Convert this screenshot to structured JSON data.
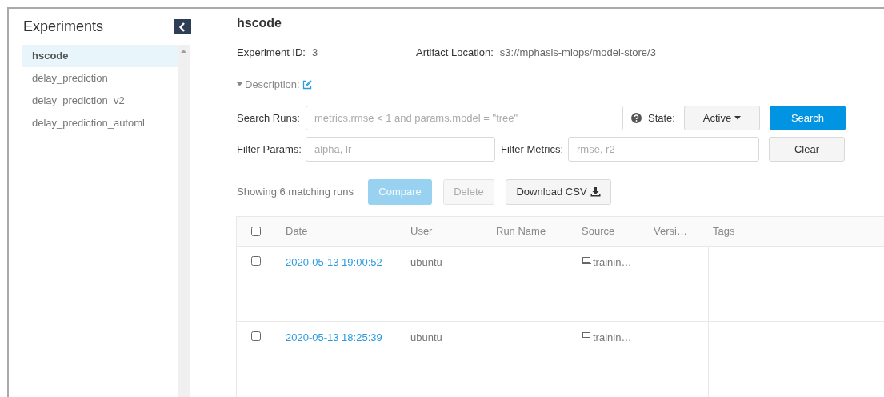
{
  "sidebar": {
    "title": "Experiments",
    "items": [
      {
        "label": "hscode",
        "selected": true
      },
      {
        "label": "delay_prediction",
        "selected": false
      },
      {
        "label": "delay_prediction_v2",
        "selected": false
      },
      {
        "label": "delay_prediction_automl",
        "selected": false
      }
    ]
  },
  "experiment": {
    "title": "hscode",
    "id_label": "Experiment ID:",
    "id_value": "3",
    "location_label": "Artifact Location:",
    "location_value": "s3://mphasis-mlops/model-store/3",
    "description_label": "Description:",
    "description_expanded": true
  },
  "search": {
    "label": "Search Runs:",
    "placeholder": "metrics.rmse < 1 and params.model = \"tree\"",
    "state_label": "State:",
    "state_value": "Active",
    "search_button": "Search"
  },
  "filters": {
    "params_label": "Filter Params:",
    "params_placeholder": "alpha, lr",
    "metrics_label": "Filter Metrics:",
    "metrics_placeholder": "rmse, r2",
    "clear_button": "Clear"
  },
  "actions": {
    "count": "Showing 6 matching runs",
    "compare": {
      "label": "Compare",
      "disabled": true
    },
    "delete": {
      "label": "Delete",
      "disabled": true
    },
    "download": {
      "label": "Download CSV",
      "disabled": false
    }
  },
  "table": {
    "select_all_checked": false,
    "columns": [
      "Date",
      "User",
      "Run Name",
      "Source",
      "Versi…",
      "Tags"
    ],
    "rows": [
      {
        "checked": false,
        "date": "2020-05-13 19:00:52",
        "user": "ubuntu",
        "source": "trainin…"
      },
      {
        "checked": false,
        "date": "2020-05-13 18:25:39",
        "user": "ubuntu",
        "source": "trainin…"
      }
    ]
  }
}
